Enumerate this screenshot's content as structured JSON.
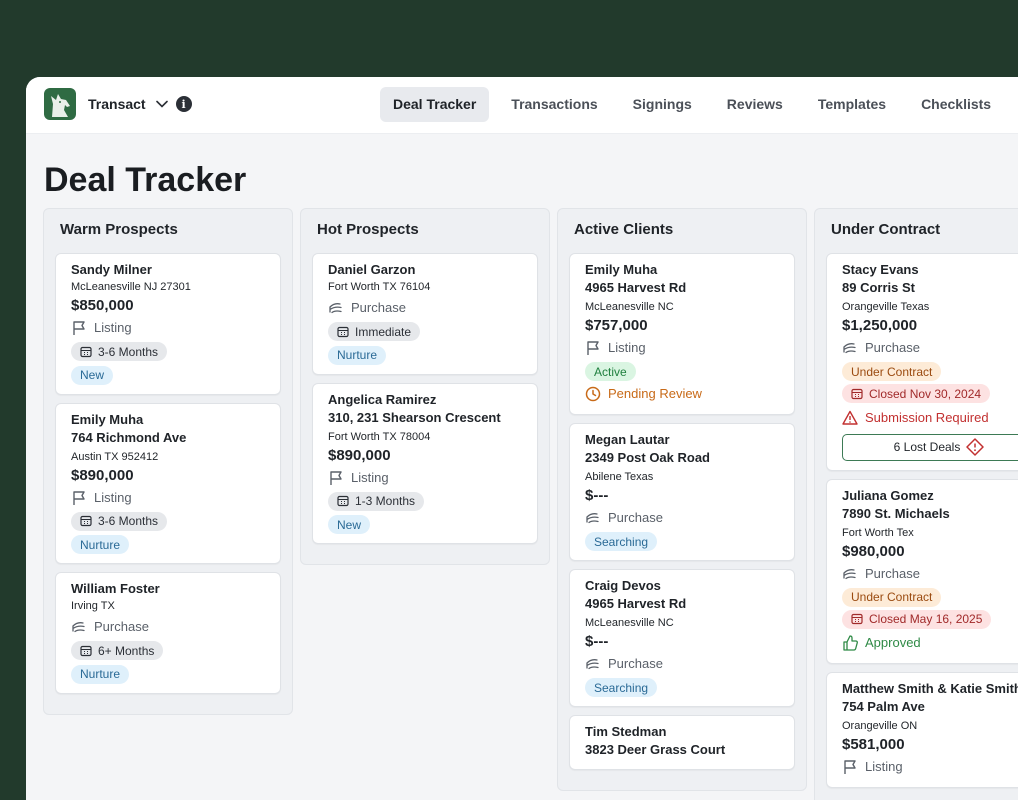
{
  "app": {
    "name": "Transact"
  },
  "nav": [
    {
      "label": "Deal Tracker",
      "active": true
    },
    {
      "label": "Transactions"
    },
    {
      "label": "Signings"
    },
    {
      "label": "Reviews"
    },
    {
      "label": "Templates"
    },
    {
      "label": "Checklists"
    }
  ],
  "page": {
    "title": "Deal Tracker"
  },
  "columns": [
    {
      "title": "Warm Prospects",
      "cards": [
        {
          "name": "Sandy Milner",
          "city": "McLeanesville NJ 27301",
          "price": "$850,000",
          "type": "Listing",
          "timeline": "3-6 Months",
          "stage": "New"
        },
        {
          "name": "Emily Muha",
          "street": "764 Richmond Ave",
          "city": "Austin TX 952412",
          "price": "$890,000",
          "type": "Listing",
          "timeline": "3-6 Months",
          "stage": "Nurture"
        },
        {
          "name": "William Foster",
          "city": "Irving TX",
          "type": "Purchase",
          "timeline": "6+ Months",
          "stage": "Nurture"
        }
      ]
    },
    {
      "title": "Hot Prospects",
      "cards": [
        {
          "name": "Daniel Garzon",
          "city": "Fort Worth TX 76104",
          "type": "Purchase",
          "timeline": "Immediate",
          "stage": "Nurture"
        },
        {
          "name": "Angelica Ramirez",
          "street": "310, 231 Shearson Crescent",
          "city": "Fort Worth TX 78004",
          "price": "$890,000",
          "type": "Listing",
          "timeline": "1-3 Months",
          "stage": "New"
        }
      ]
    },
    {
      "title": "Active Clients",
      "cards": [
        {
          "name": "Emily Muha",
          "street": "4965 Harvest Rd",
          "city": "McLeanesville NC",
          "price": "$757,000",
          "type": "Listing",
          "stage": "Active",
          "status": "Pending Review"
        },
        {
          "name": "Megan Lautar",
          "street": "2349 Post Oak Road",
          "city": "Abilene Texas",
          "price": "$---",
          "type": "Purchase",
          "stage": "Searching"
        },
        {
          "name": "Craig Devos",
          "street": "4965 Harvest Rd",
          "city": "McLeanesville NC",
          "price": "$---",
          "type": "Purchase",
          "stage": "Searching"
        },
        {
          "name": "Tim Stedman",
          "street": "3823 Deer Grass Court"
        }
      ]
    },
    {
      "title": "Under Contract",
      "cards": [
        {
          "name": "Stacy Evans",
          "street": "89 Corris St",
          "city": "Orangeville Texas",
          "price": "$1,250,000",
          "type": "Purchase",
          "stage": "Under Contract",
          "closed": "Closed Nov 30, 2024",
          "status": "Submission Required",
          "lost": "6 Lost Deals"
        },
        {
          "name": "Juliana Gomez",
          "street": "7890 St. Michaels",
          "city": "Fort Worth Tex",
          "price": "$980,000",
          "type": "Purchase",
          "stage": "Under Contract",
          "closed": "Closed May 16, 2025",
          "status": "Approved"
        },
        {
          "name": "Matthew Smith & Katie Smith",
          "street": "754 Palm Ave",
          "city": "Orangeville ON",
          "price": "$581,000",
          "type": "Listing"
        }
      ]
    }
  ]
}
